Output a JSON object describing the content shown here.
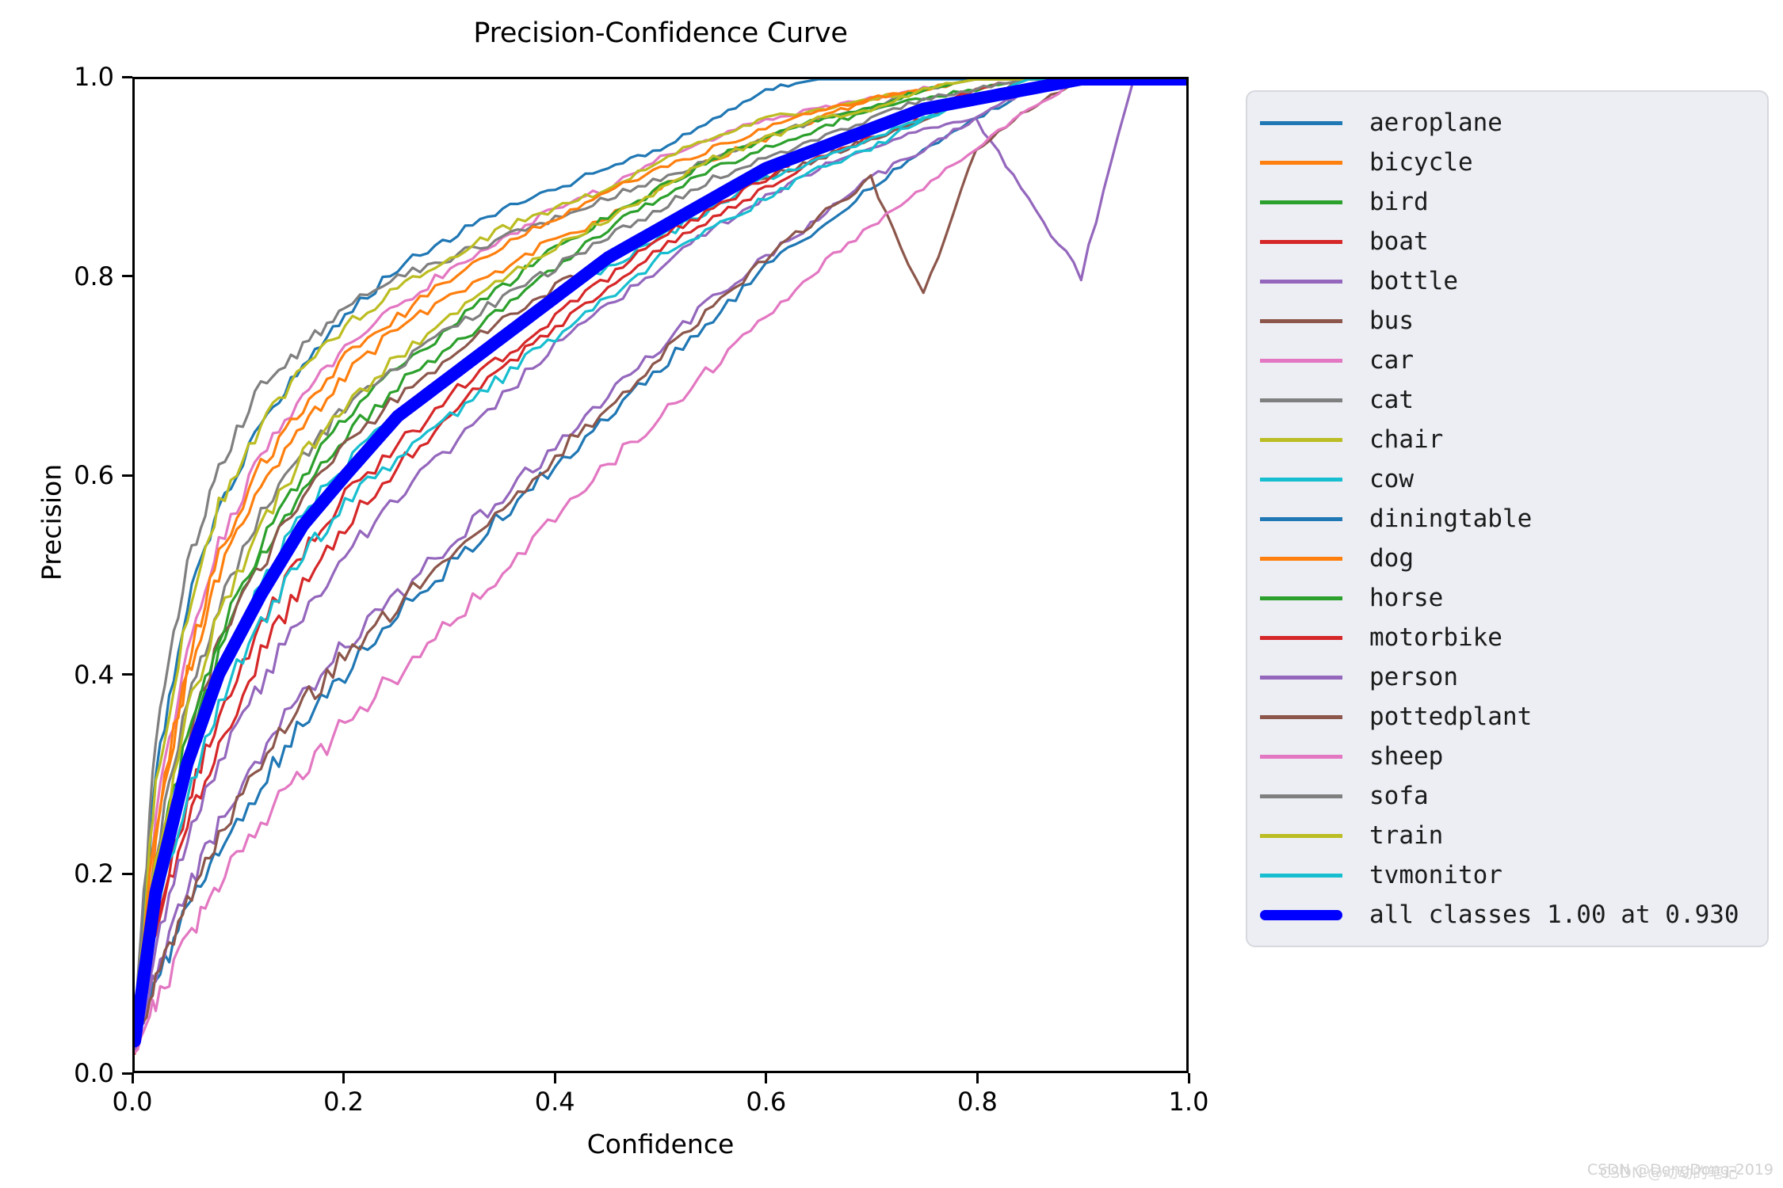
{
  "chart_data": {
    "type": "line",
    "title": "Precision-Confidence Curve",
    "xlabel": "Confidence",
    "ylabel": "Precision",
    "xlim": [
      0.0,
      1.0
    ],
    "ylim": [
      0.0,
      1.0
    ],
    "xticks": [
      "0.0",
      "0.2",
      "0.4",
      "0.6",
      "0.8",
      "1.0"
    ],
    "xtick_values": [
      0.0,
      0.2,
      0.4,
      0.6,
      0.8,
      1.0
    ],
    "yticks": [
      "0.0",
      "0.2",
      "0.4",
      "0.6",
      "0.8",
      "1.0"
    ],
    "ytick_values": [
      0.0,
      0.2,
      0.4,
      0.6,
      0.8,
      1.0
    ],
    "grid": false,
    "legend_position": "right-outside",
    "x": [
      0.0,
      0.02,
      0.05,
      0.08,
      0.12,
      0.16,
      0.2,
      0.25,
      0.3,
      0.35,
      0.4,
      0.45,
      0.5,
      0.55,
      0.6,
      0.65,
      0.7,
      0.75,
      0.8,
      0.85,
      0.9,
      0.95,
      1.0
    ],
    "series": [
      {
        "name": "aeroplane",
        "color": "#1f77b4",
        "values": [
          0.04,
          0.3,
          0.47,
          0.57,
          0.65,
          0.71,
          0.76,
          0.81,
          0.84,
          0.87,
          0.89,
          0.91,
          0.93,
          0.96,
          0.99,
          1.0,
          1.0,
          1.0,
          1.0,
          1.0,
          1.0,
          1.0,
          1.0
        ]
      },
      {
        "name": "bicycle",
        "color": "#ff7f0e",
        "values": [
          0.03,
          0.24,
          0.4,
          0.5,
          0.59,
          0.65,
          0.7,
          0.75,
          0.78,
          0.81,
          0.84,
          0.86,
          0.89,
          0.92,
          0.94,
          0.96,
          0.98,
          0.99,
          1.0,
          1.0,
          1.0,
          1.0,
          1.0
        ]
      },
      {
        "name": "bird",
        "color": "#2ca02c",
        "values": [
          0.03,
          0.18,
          0.32,
          0.42,
          0.52,
          0.59,
          0.64,
          0.69,
          0.73,
          0.77,
          0.81,
          0.85,
          0.88,
          0.91,
          0.93,
          0.95,
          0.97,
          0.98,
          0.99,
          1.0,
          1.0,
          1.0,
          1.0
        ]
      },
      {
        "name": "boat",
        "color": "#d62728",
        "values": [
          0.02,
          0.14,
          0.25,
          0.33,
          0.42,
          0.49,
          0.55,
          0.61,
          0.66,
          0.71,
          0.75,
          0.79,
          0.83,
          0.86,
          0.89,
          0.92,
          0.94,
          0.96,
          0.98,
          0.99,
          1.0,
          1.0,
          1.0
        ]
      },
      {
        "name": "bottle",
        "color": "#9467bd",
        "values": [
          0.02,
          0.13,
          0.23,
          0.31,
          0.39,
          0.46,
          0.52,
          0.58,
          0.63,
          0.68,
          0.73,
          0.77,
          0.81,
          0.85,
          0.88,
          0.91,
          0.93,
          0.95,
          0.96,
          0.88,
          0.8,
          1.0,
          1.0
        ]
      },
      {
        "name": "bus",
        "color": "#8c564b",
        "values": [
          0.03,
          0.19,
          0.33,
          0.43,
          0.51,
          0.58,
          0.63,
          0.68,
          0.72,
          0.76,
          0.79,
          0.82,
          0.85,
          0.88,
          0.9,
          0.92,
          0.94,
          0.96,
          0.98,
          1.0,
          1.0,
          1.0,
          1.0
        ]
      },
      {
        "name": "car",
        "color": "#e377c2",
        "values": [
          0.04,
          0.26,
          0.42,
          0.53,
          0.62,
          0.68,
          0.73,
          0.77,
          0.81,
          0.84,
          0.87,
          0.89,
          0.92,
          0.94,
          0.96,
          0.97,
          0.98,
          0.99,
          1.0,
          1.0,
          1.0,
          1.0,
          1.0
        ]
      },
      {
        "name": "cat",
        "color": "#7f7f7f",
        "values": [
          0.05,
          0.34,
          0.51,
          0.61,
          0.69,
          0.73,
          0.77,
          0.8,
          0.82,
          0.84,
          0.86,
          0.88,
          0.9,
          0.92,
          0.94,
          0.96,
          0.97,
          0.99,
          1.0,
          1.0,
          1.0,
          1.0,
          1.0
        ]
      },
      {
        "name": "chair",
        "color": "#bcbd22",
        "values": [
          0.04,
          0.29,
          0.46,
          0.57,
          0.65,
          0.71,
          0.75,
          0.79,
          0.82,
          0.85,
          0.87,
          0.89,
          0.92,
          0.94,
          0.96,
          0.97,
          0.98,
          0.99,
          1.0,
          1.0,
          1.0,
          1.0,
          1.0
        ]
      },
      {
        "name": "cow",
        "color": "#17becf",
        "values": [
          0.03,
          0.17,
          0.3,
          0.4,
          0.49,
          0.56,
          0.61,
          0.66,
          0.7,
          0.74,
          0.78,
          0.81,
          0.84,
          0.87,
          0.9,
          0.92,
          0.94,
          0.96,
          0.98,
          1.0,
          1.0,
          1.0,
          1.0
        ]
      },
      {
        "name": "diningtable",
        "color": "#1f77b4",
        "values": [
          0.02,
          0.09,
          0.16,
          0.22,
          0.29,
          0.35,
          0.4,
          0.46,
          0.51,
          0.56,
          0.61,
          0.66,
          0.71,
          0.76,
          0.81,
          0.85,
          0.89,
          0.93,
          0.96,
          0.99,
          1.0,
          1.0,
          1.0
        ]
      },
      {
        "name": "dog",
        "color": "#ff7f0e",
        "values": [
          0.04,
          0.25,
          0.41,
          0.52,
          0.61,
          0.67,
          0.72,
          0.76,
          0.8,
          0.83,
          0.86,
          0.89,
          0.91,
          0.93,
          0.95,
          0.97,
          0.98,
          0.99,
          1.0,
          1.0,
          1.0,
          1.0,
          1.0
        ]
      },
      {
        "name": "horse",
        "color": "#2ca02c",
        "values": [
          0.03,
          0.2,
          0.34,
          0.44,
          0.53,
          0.6,
          0.66,
          0.71,
          0.75,
          0.79,
          0.83,
          0.86,
          0.89,
          0.92,
          0.94,
          0.96,
          0.97,
          0.99,
          1.0,
          1.0,
          1.0,
          1.0,
          1.0
        ]
      },
      {
        "name": "motorbike",
        "color": "#d62728",
        "values": [
          0.02,
          0.15,
          0.27,
          0.36,
          0.45,
          0.52,
          0.58,
          0.63,
          0.68,
          0.72,
          0.76,
          0.8,
          0.84,
          0.87,
          0.9,
          0.93,
          0.95,
          0.97,
          0.99,
          1.0,
          1.0,
          1.0,
          1.0
        ]
      },
      {
        "name": "person",
        "color": "#9467bd",
        "values": [
          0.02,
          0.1,
          0.18,
          0.25,
          0.32,
          0.38,
          0.43,
          0.48,
          0.53,
          0.58,
          0.63,
          0.68,
          0.73,
          0.78,
          0.82,
          0.86,
          0.9,
          0.93,
          0.96,
          0.99,
          1.0,
          1.0,
          1.0
        ]
      },
      {
        "name": "pottedplant",
        "color": "#8c564b",
        "values": [
          0.02,
          0.09,
          0.17,
          0.24,
          0.31,
          0.37,
          0.42,
          0.47,
          0.52,
          0.57,
          0.62,
          0.67,
          0.72,
          0.77,
          0.82,
          0.86,
          0.9,
          0.78,
          0.93,
          0.97,
          1.0,
          1.0,
          1.0
        ]
      },
      {
        "name": "sheep",
        "color": "#e377c2",
        "values": [
          0.02,
          0.07,
          0.13,
          0.19,
          0.25,
          0.3,
          0.35,
          0.4,
          0.45,
          0.5,
          0.56,
          0.61,
          0.66,
          0.71,
          0.76,
          0.81,
          0.85,
          0.89,
          0.93,
          0.97,
          1.0,
          1.0,
          1.0
        ]
      },
      {
        "name": "sofa",
        "color": "#7f7f7f",
        "values": [
          0.04,
          0.22,
          0.37,
          0.47,
          0.56,
          0.62,
          0.67,
          0.71,
          0.75,
          0.78,
          0.81,
          0.84,
          0.87,
          0.9,
          0.92,
          0.94,
          0.96,
          0.98,
          0.99,
          1.0,
          1.0,
          1.0,
          1.0
        ]
      },
      {
        "name": "train",
        "color": "#bcbd22",
        "values": [
          0.03,
          0.21,
          0.36,
          0.46,
          0.55,
          0.62,
          0.67,
          0.72,
          0.76,
          0.8,
          0.83,
          0.86,
          0.89,
          0.92,
          0.94,
          0.96,
          0.97,
          0.99,
          1.0,
          1.0,
          1.0,
          1.0,
          1.0
        ]
      },
      {
        "name": "tvmonitor",
        "color": "#17becf",
        "values": [
          0.03,
          0.16,
          0.28,
          0.37,
          0.45,
          0.52,
          0.57,
          0.62,
          0.66,
          0.7,
          0.74,
          0.78,
          0.82,
          0.85,
          0.88,
          0.91,
          0.93,
          0.96,
          0.98,
          1.0,
          1.0,
          1.0,
          1.0
        ]
      },
      {
        "name": "all classes 1.00 at 0.930",
        "color": "#0000ff",
        "thick": true,
        "values": [
          0.03,
          0.18,
          0.31,
          0.4,
          0.48,
          0.55,
          0.6,
          0.66,
          0.7,
          0.74,
          0.78,
          0.82,
          0.85,
          0.88,
          0.91,
          0.93,
          0.95,
          0.97,
          0.98,
          0.99,
          1.0,
          1.0,
          1.0
        ]
      }
    ]
  },
  "legend": {
    "entries": [
      {
        "label": "aeroplane",
        "color": "#1f77b4",
        "thick": false
      },
      {
        "label": "bicycle",
        "color": "#ff7f0e",
        "thick": false
      },
      {
        "label": "bird",
        "color": "#2ca02c",
        "thick": false
      },
      {
        "label": "boat",
        "color": "#d62728",
        "thick": false
      },
      {
        "label": "bottle",
        "color": "#9467bd",
        "thick": false
      },
      {
        "label": "bus",
        "color": "#8c564b",
        "thick": false
      },
      {
        "label": "car",
        "color": "#e377c2",
        "thick": false
      },
      {
        "label": "cat",
        "color": "#7f7f7f",
        "thick": false
      },
      {
        "label": "chair",
        "color": "#bcbd22",
        "thick": false
      },
      {
        "label": "cow",
        "color": "#17becf",
        "thick": false
      },
      {
        "label": "diningtable",
        "color": "#1f77b4",
        "thick": false
      },
      {
        "label": "dog",
        "color": "#ff7f0e",
        "thick": false
      },
      {
        "label": "horse",
        "color": "#2ca02c",
        "thick": false
      },
      {
        "label": "motorbike",
        "color": "#d62728",
        "thick": false
      },
      {
        "label": "person",
        "color": "#9467bd",
        "thick": false
      },
      {
        "label": "pottedplant",
        "color": "#8c564b",
        "thick": false
      },
      {
        "label": "sheep",
        "color": "#e377c2",
        "thick": false
      },
      {
        "label": "sofa",
        "color": "#7f7f7f",
        "thick": false
      },
      {
        "label": "train",
        "color": "#bcbd22",
        "thick": false
      },
      {
        "label": "tvmonitor",
        "color": "#17becf",
        "thick": false
      },
      {
        "label": "all classes 1.00 at 0.930",
        "color": "#0000ff",
        "thick": true
      }
    ]
  },
  "watermark": {
    "text_a": "CSDN @DongDong-2019",
    "text_b": "CSDN @动动的笔记"
  }
}
